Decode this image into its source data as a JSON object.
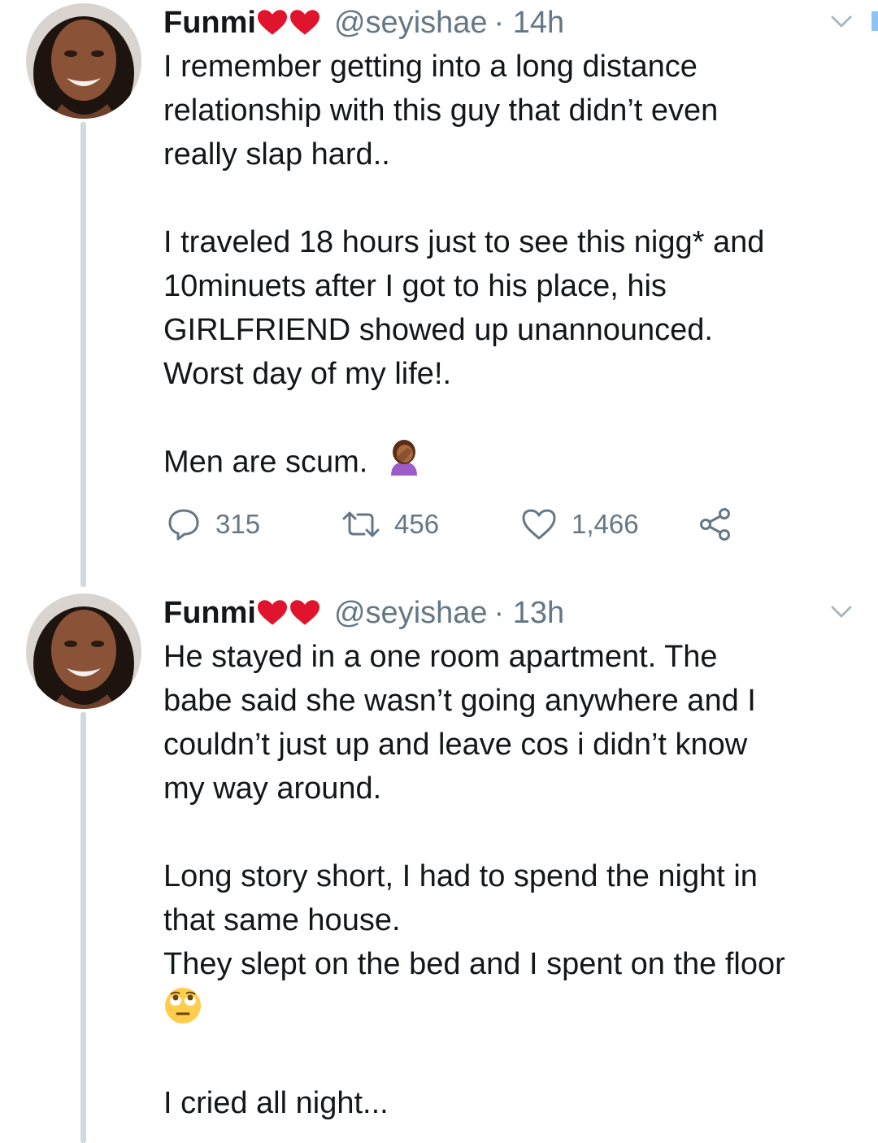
{
  "tweets": [
    {
      "name": "Funmi",
      "hearts_icon": "two-red-hearts",
      "handle": "@seyishae",
      "time": "· 14h",
      "lines_p1": [
        "I remember getting into a long distance",
        "relationship with this guy that didn’t even",
        "really slap hard.."
      ],
      "lines_p2": [
        "I traveled 18 hours just to see this nigg* and",
        "10minuets after I got to his place, his",
        "GIRLFRIEND showed up unannounced.",
        "Worst day of my life!."
      ],
      "line_p3": "Men are scum.",
      "p3_emoji": "woman-facepalming-emoji",
      "stats": {
        "replies": "315",
        "retweets": "456",
        "likes": "1,466"
      }
    },
    {
      "name": "Funmi",
      "hearts_icon": "two-red-hearts",
      "handle": "@seyishae",
      "time": "· 13h",
      "lines_p1": [
        "He stayed in a one room apartment. The",
        "babe said she wasn’t going anywhere and I",
        "couldn’t just up and leave cos i didn’t know",
        "my way around."
      ],
      "lines_p2": [
        "Long story short, I had to spend the night in",
        "that same house.",
        "They slept on the bed and I spent on the floor"
      ],
      "p2_emoji": "face-with-rolling-eyes-emoji",
      "line_p3": "I cried all night..."
    }
  ],
  "colors": {
    "accent": "#1da1f2",
    "heart": "#e0142c",
    "muted": "#657786",
    "thread": "#cfd9de"
  }
}
